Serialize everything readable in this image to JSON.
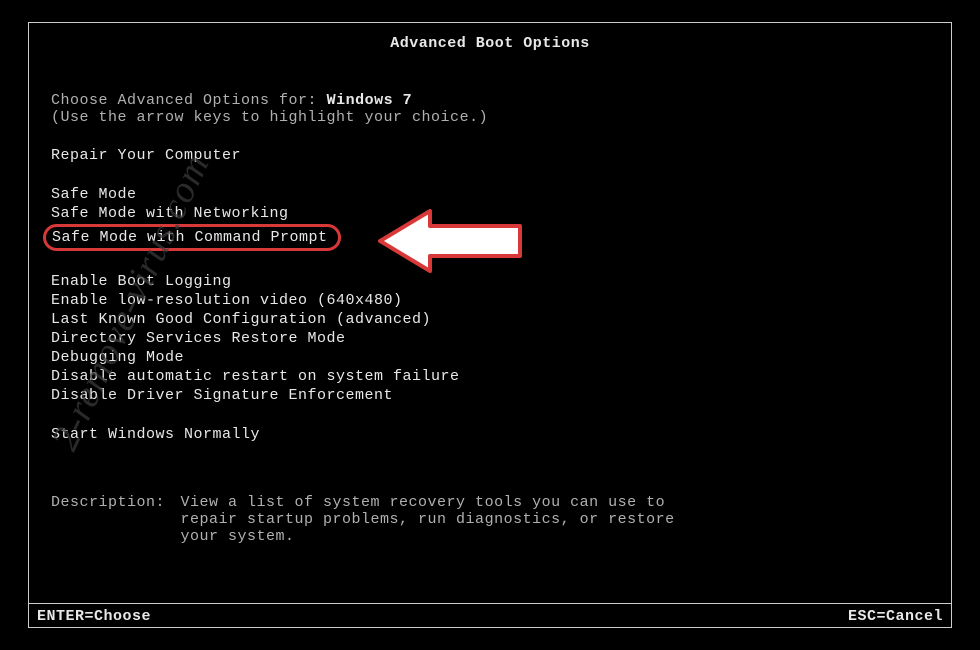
{
  "title": "Advanced Boot Options",
  "chooseLabel": "Choose Advanced Options for:",
  "os": "Windows 7",
  "hint": "(Use the arrow keys to highlight your choice.)",
  "repair": "Repair Your Computer",
  "options": {
    "safeMode": "Safe Mode",
    "safeModeNet": "Safe Mode with Networking",
    "safeModeCmd": "Safe Mode with Command Prompt",
    "bootLog": "Enable Boot Logging",
    "lowRes": "Enable low-resolution video (640x480)",
    "lkgc": "Last Known Good Configuration (advanced)",
    "dsrm": "Directory Services Restore Mode",
    "debug": "Debugging Mode",
    "noRestart": "Disable automatic restart on system failure",
    "noDrvSig": "Disable Driver Signature Enforcement",
    "startNormal": "Start Windows Normally"
  },
  "descLabel": "Description:",
  "descText": "View a list of system recovery tools you can use to repair startup problems, run diagnostics, or restore your system.",
  "footer": {
    "enter": "ENTER=Choose",
    "esc": "ESC=Cancel"
  },
  "watermark": "2-remove-virus.com"
}
